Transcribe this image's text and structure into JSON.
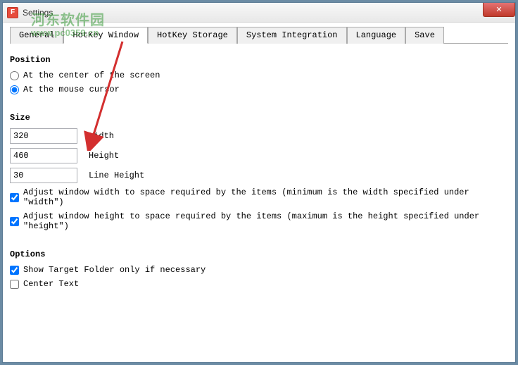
{
  "window": {
    "title": "Settings",
    "close_glyph": "✕"
  },
  "tabs": {
    "general": "General",
    "hotkey_window": "HotKey Window",
    "hotkey_storage": "HotKey Storage",
    "system_integration": "System Integration",
    "language": "Language",
    "save": "Save"
  },
  "position": {
    "title": "Position",
    "center": "At the center of the screen",
    "cursor": "At the mouse cursor"
  },
  "size": {
    "title": "Size",
    "width_value": "320",
    "width_label": "Width",
    "height_value": "460",
    "height_label": "Height",
    "line_height_value": "30",
    "line_height_label": "Line Height",
    "adjust_width": "Adjust window width to space required by the items (minimum is the width specified under \"width\")",
    "adjust_height": "Adjust window height to space required by the items (maximum is the height specified under \"height\")"
  },
  "options": {
    "title": "Options",
    "show_target": "Show Target Folder only if necessary",
    "center_text": "Center Text"
  },
  "watermark": {
    "line1": "河东软件园",
    "line2": "www.pc0359.cn"
  }
}
